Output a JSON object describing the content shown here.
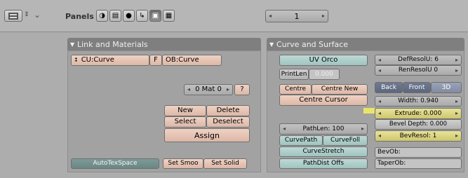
{
  "header": {
    "panels_label": "Panels",
    "frame_number": "1"
  },
  "link_panel": {
    "title": "Link and Materials",
    "curve_data_name": "CU:Curve",
    "fake_user": "F",
    "object_name": "OB:Curve",
    "material_index": "0 Mat 0",
    "material_help": "?",
    "new_label": "New",
    "delete_label": "Delete",
    "select_label": "Select",
    "deselect_label": "Deselect",
    "assign_label": "Assign",
    "auto_tex_space": "AutoTexSpace",
    "set_smooth": "Set Smoo",
    "set_solid": "Set Solid"
  },
  "curve_panel": {
    "title": "Curve and Surface",
    "uv_orco": "UV Orco",
    "print_len_label": "PrintLen",
    "print_len_value": "0.000",
    "centre": "Centre",
    "centre_new": "Centre New",
    "centre_cursor": "Centre Cursor",
    "def_resol_u": "DefResolU: 6",
    "ren_resol_u": "RenResolU 0",
    "back": "Back",
    "front": "Front",
    "thirty_d": "3D",
    "width": "Width: 0.940",
    "extrude": "Extrude: 0.000",
    "bevel_depth": "Bevel Depth: 0.000",
    "bev_resol": "BevResol: 1",
    "path_len": "PathLen: 100",
    "curve_path": "CurvePath",
    "curve_follow": "CurveFoll",
    "curve_stretch": "CurveStretch",
    "path_dist_offs": "PathDist Offs",
    "bev_ob": "BevOb:",
    "taper_ob": "TaperOb:"
  }
}
